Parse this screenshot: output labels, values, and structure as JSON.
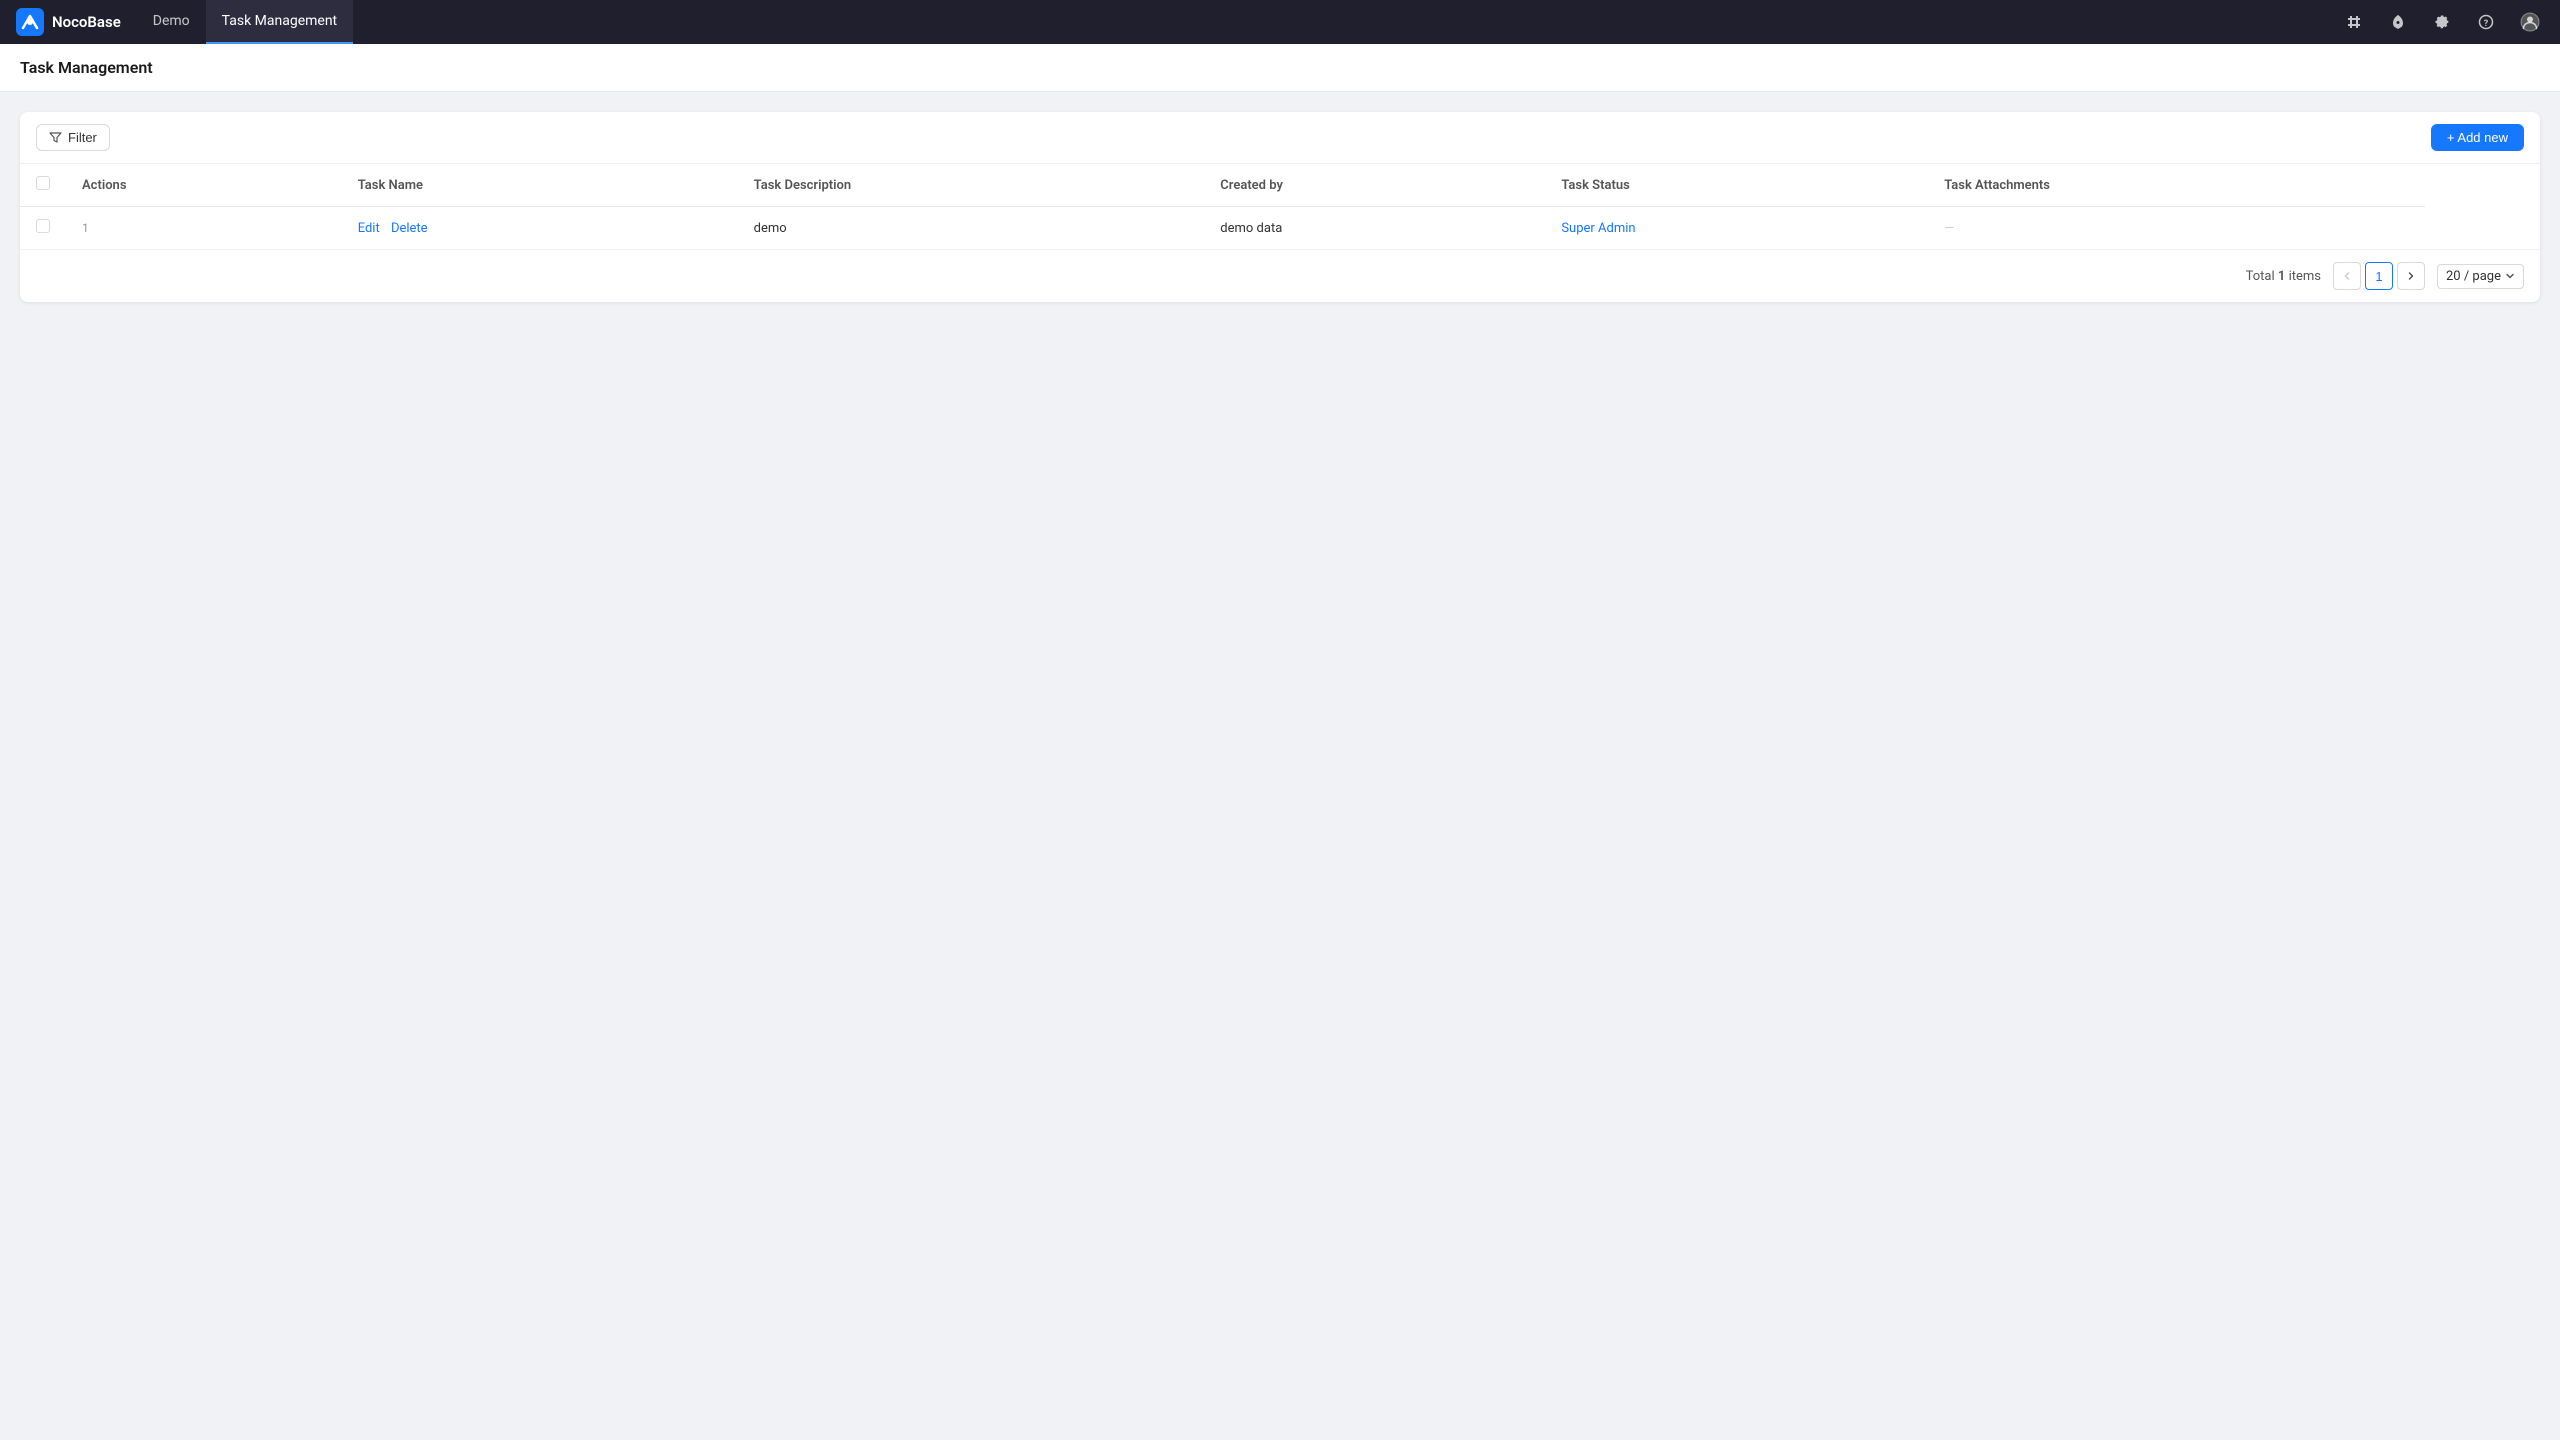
{
  "app": {
    "logo_text": "NocoBase",
    "nav_tabs": [
      {
        "label": "Demo",
        "active": false
      },
      {
        "label": "Task Management",
        "active": true
      }
    ],
    "navbar_icons": [
      {
        "name": "plugin-icon",
        "symbol": "🔌"
      },
      {
        "name": "rocket-icon",
        "symbol": "🚀"
      },
      {
        "name": "settings-icon",
        "symbol": "⚙"
      },
      {
        "name": "help-icon",
        "symbol": "?"
      },
      {
        "name": "user-icon",
        "symbol": "👤"
      }
    ]
  },
  "page": {
    "title": "Task Management"
  },
  "toolbar": {
    "filter_label": "Filter",
    "add_new_label": "+ Add new"
  },
  "table": {
    "columns": [
      {
        "key": "actions",
        "label": "Actions"
      },
      {
        "key": "task_name",
        "label": "Task Name"
      },
      {
        "key": "task_description",
        "label": "Task Description"
      },
      {
        "key": "created_by",
        "label": "Created by"
      },
      {
        "key": "task_status",
        "label": "Task Status"
      },
      {
        "key": "task_attachments",
        "label": "Task Attachments"
      }
    ],
    "rows": [
      {
        "row_number": "1",
        "actions": {
          "edit": "Edit",
          "delete": "Delete"
        },
        "task_name": "demo",
        "task_description": "demo data",
        "created_by": "Super Admin",
        "task_status": "—",
        "task_attachments": ""
      }
    ]
  },
  "pagination": {
    "total_label": "Total",
    "total_count": "1",
    "items_label": "items",
    "current_page": "1",
    "per_page_label": "20 / page"
  }
}
